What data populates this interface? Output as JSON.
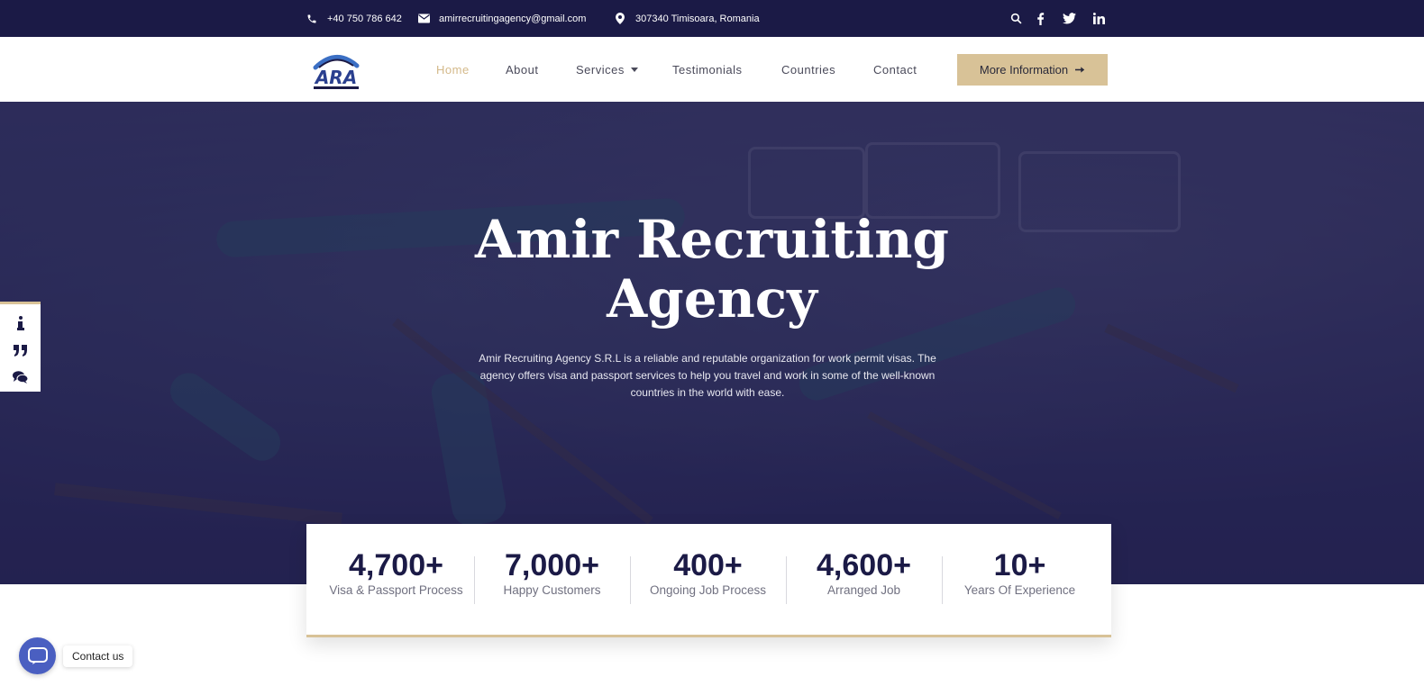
{
  "topbar": {
    "phone": "+40 750 786 642",
    "email": "amirrecruitingagency@gmail.com",
    "address": "307340 Timisoara, Romania",
    "icons": [
      "phone-icon",
      "mail-icon",
      "location-pin-icon",
      "search-icon",
      "facebook-icon",
      "twitter-icon",
      "linkedin-icon"
    ]
  },
  "brand": {
    "logo_text": "ARA",
    "logo_subtitle": "AMIR RECRUITING AGENCY"
  },
  "nav": {
    "items": [
      {
        "label": "Home",
        "active": true
      },
      {
        "label": "About"
      },
      {
        "label": "Services",
        "dropdown": true
      },
      {
        "label": "Testimonials"
      },
      {
        "label": "Countries"
      },
      {
        "label": "Contact"
      }
    ],
    "cta_label": "More Information",
    "cta_icon": "arrow-right-icon"
  },
  "hero": {
    "title_line1": "Amir Recruiting",
    "title_line2": "Agency",
    "description": "Amir Recruiting Agency S.R.L is a reliable and reputable organization for work permit visas. The agency offers visa and passport services to help you travel and work in some of the well-known countries in the world with ease."
  },
  "side_widget": {
    "icons": [
      "info-icon",
      "quote-icon",
      "comments-icon"
    ]
  },
  "stats": [
    {
      "value": "4,700+",
      "label": "Visa & Passport Process"
    },
    {
      "value": "7,000+",
      "label": "Happy Customers"
    },
    {
      "value": "400+",
      "label": "Ongoing Job Process"
    },
    {
      "value": "4,600+",
      "label": "Arranged Job"
    },
    {
      "value": "10+",
      "label": "Years Of Experience"
    }
  ],
  "chat": {
    "label": "Contact us"
  },
  "colors": {
    "navy": "#1b1a46",
    "gold": "#d8c297",
    "active_nav": "#d4b98a",
    "chat_blue": "#4a5fc1"
  }
}
